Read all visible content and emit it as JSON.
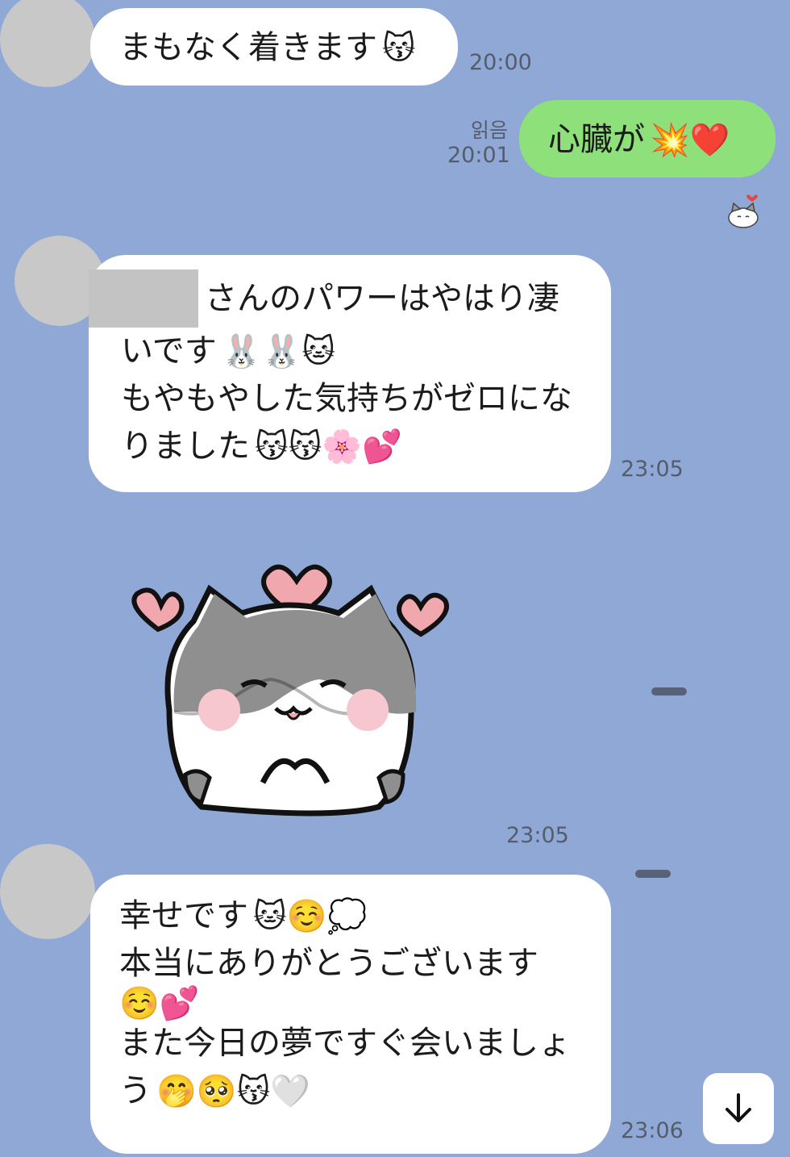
{
  "messages": [
    {
      "text": "まもなく着きます",
      "emoji": "😽",
      "time": "20:00"
    },
    {
      "text": "心臓が",
      "emoji": "💥❤️",
      "time": "20:01",
      "read": "읽음"
    },
    {
      "lines": [
        "さんのパワーはやはり凄",
        "いです",
        "もやもやした気持ちがゼロにな",
        "りました"
      ],
      "emoji_line2": "🐰🐰🐱",
      "emoji_line4": "😽😽🌸💕",
      "time": "23:05"
    },
    {
      "sticker_time": "23:05"
    },
    {
      "lines": [
        "幸せです",
        "本当にありがとうございます",
        "",
        "また今日の夢ですぐ会いましょ",
        "う"
      ],
      "emoji_line1": "🐱☺️💭",
      "emoji_line3": "☺️💕",
      "emoji_line5": "🤭🥺😽🤍",
      "time": "23:06"
    }
  ],
  "reaction_icon": "cat-heart-reaction-icon",
  "scroll_button_icon": "arrow-down-icon",
  "colors": {
    "background": "#8fa8d6",
    "incoming_bubble": "#ffffff",
    "outgoing_bubble": "#8de07a",
    "avatar_placeholder": "#c8c8c8"
  }
}
